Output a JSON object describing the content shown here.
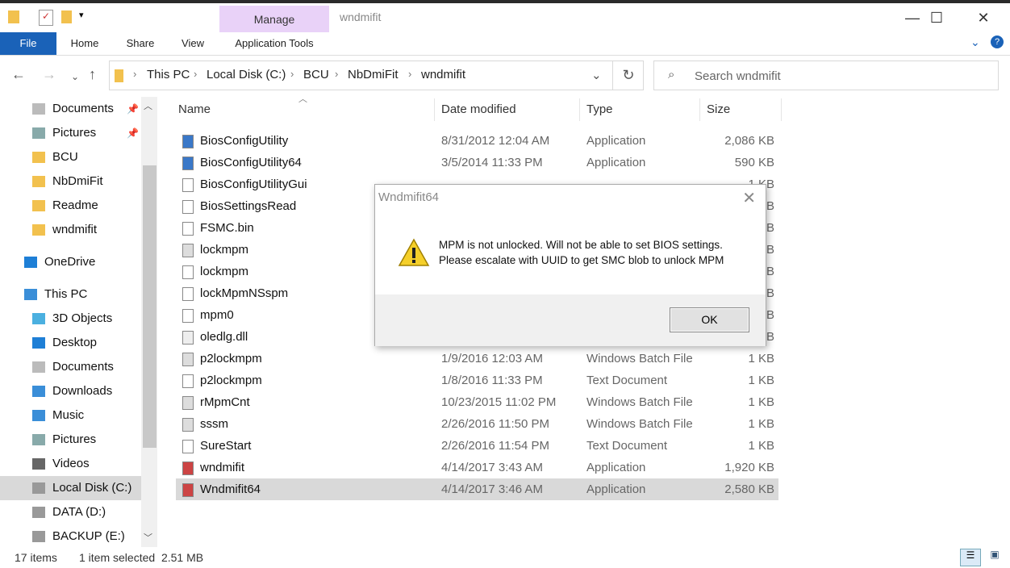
{
  "window": {
    "title": "wndmifit",
    "minimize": "—",
    "maximize": "☐",
    "close": "✕"
  },
  "ribbon": {
    "manage": "Manage",
    "tabs": [
      "File",
      "Home",
      "Share",
      "View",
      "Application Tools"
    ]
  },
  "address": {
    "crumbs": [
      "This PC",
      "Local Disk (C:)",
      "BCU",
      "NbDmiFit",
      "wndmifit"
    ]
  },
  "search": {
    "placeholder": "Search wndmifit"
  },
  "sidebar": [
    {
      "label": "Documents",
      "icon": "documents-icon",
      "pinned": true
    },
    {
      "label": "Pictures",
      "icon": "pictures-icon",
      "pinned": true
    },
    {
      "label": "BCU",
      "icon": "folder-icon"
    },
    {
      "label": "NbDmiFit",
      "icon": "folder-icon"
    },
    {
      "label": "Readme",
      "icon": "folder-icon"
    },
    {
      "label": "wndmifit",
      "icon": "folder-icon"
    },
    {
      "label": "OneDrive",
      "icon": "cloud-icon"
    },
    {
      "label": "This PC",
      "icon": "computer-icon"
    },
    {
      "label": "3D Objects",
      "icon": "cube-icon"
    },
    {
      "label": "Desktop",
      "icon": "desktop-icon"
    },
    {
      "label": "Documents",
      "icon": "documents-icon"
    },
    {
      "label": "Downloads",
      "icon": "download-icon"
    },
    {
      "label": "Music",
      "icon": "music-icon"
    },
    {
      "label": "Pictures",
      "icon": "pictures-icon"
    },
    {
      "label": "Videos",
      "icon": "videos-icon"
    },
    {
      "label": "Local Disk (C:)",
      "icon": "drive-icon"
    },
    {
      "label": "DATA (D:)",
      "icon": "drive-icon"
    },
    {
      "label": "BACKUP (E:)",
      "icon": "drive-icon"
    }
  ],
  "columns": [
    "Name",
    "Date modified",
    "Type",
    "Size"
  ],
  "files": [
    {
      "name": "BiosConfigUtility",
      "date": "8/31/2012 12:04 AM",
      "type": "Application",
      "size": "2,086 KB",
      "icon": "app"
    },
    {
      "name": "BiosConfigUtility64",
      "date": "3/5/2014 11:33 PM",
      "type": "Application",
      "size": "590 KB",
      "icon": "app"
    },
    {
      "name": "BiosConfigUtilityGui",
      "date": "",
      "type": "",
      "size": "1 KB",
      "icon": "text"
    },
    {
      "name": "BiosSettingsRead",
      "date": "",
      "type": "",
      "size": "1 KB",
      "icon": "text"
    },
    {
      "name": "FSMC.bin",
      "date": "",
      "type": "",
      "size": "1 KB",
      "icon": "file"
    },
    {
      "name": "lockmpm",
      "date": "",
      "type": "",
      "size": "1 KB",
      "icon": "batch"
    },
    {
      "name": "lockmpm",
      "date": "",
      "type": "",
      "size": "1 KB",
      "icon": "text"
    },
    {
      "name": "lockMpmNSspm",
      "date": "",
      "type": "",
      "size": "1 KB",
      "icon": "text"
    },
    {
      "name": "mpm0",
      "date": "",
      "type": "",
      "size": "1 KB",
      "icon": "text"
    },
    {
      "name": "oledlg.dll",
      "date": "",
      "type": "",
      "size": "1 KB",
      "icon": "dll"
    },
    {
      "name": "p2lockmpm",
      "date": "1/9/2016 12:03 AM",
      "type": "Windows Batch File",
      "size": "1 KB",
      "icon": "batch"
    },
    {
      "name": "p2lockmpm",
      "date": "1/8/2016 11:33 PM",
      "type": "Text Document",
      "size": "1 KB",
      "icon": "text"
    },
    {
      "name": "rMpmCnt",
      "date": "10/23/2015 11:02 PM",
      "type": "Windows Batch File",
      "size": "1 KB",
      "icon": "batch"
    },
    {
      "name": "sssm",
      "date": "2/26/2016 11:50 PM",
      "type": "Windows Batch File",
      "size": "1 KB",
      "icon": "batch"
    },
    {
      "name": "SureStart",
      "date": "2/26/2016 11:54 PM",
      "type": "Text Document",
      "size": "1 KB",
      "icon": "text"
    },
    {
      "name": "wndmifit",
      "date": "4/14/2017 3:43 AM",
      "type": "Application",
      "size": "1,920 KB",
      "icon": "exe"
    },
    {
      "name": "Wndmifit64",
      "date": "4/14/2017 3:46 AM",
      "type": "Application",
      "size": "2,580 KB",
      "icon": "exe",
      "selected": true
    }
  ],
  "status": {
    "count": "17 items",
    "selection": "1 item selected  2.51 MB"
  },
  "dialog": {
    "title": "Wndmifit64",
    "line1": "MPM is not unlocked.  Will not be able to set BIOS settings.",
    "line2": "Please escalate with UUID to get SMC blob to unlock MPM",
    "ok": "OK"
  }
}
